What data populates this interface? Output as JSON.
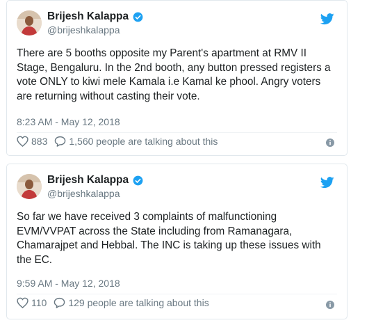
{
  "tweets": [
    {
      "author_name": "Brijesh Kalappa",
      "handle": "@brijeshkalappa",
      "text": "There are 5 booths opposite my Parent's apartment at RMV II Stage, Bengaluru. In the 2nd booth, any button pressed registers a vote ONLY to kiwi mele Kamala i.e Kamal ke phool. Angry voters are returning without casting their vote.",
      "timestamp": "8:23 AM - May 12, 2018",
      "likes": "883",
      "talking": "1,560 people are talking about this"
    },
    {
      "author_name": "Brijesh Kalappa",
      "handle": "@brijeshkalappa",
      "text": "So far we have received 3 complaints of malfunctioning EVM/VVPAT across the State including from Ramanagara, Chamarajpet and Hebbal. The INC is taking up these issues with the EC.",
      "timestamp": "9:59 AM - May 12, 2018",
      "likes": "110",
      "talking": "129 people are talking about this"
    }
  ],
  "colors": {
    "twitter_blue": "#1da1f2",
    "muted_text": "#697882",
    "border": "#e1e8ed"
  },
  "icons": [
    "avatar",
    "verified-badge-icon",
    "twitter-bird-icon",
    "heart-icon",
    "reply-bubble-icon",
    "info-icon"
  ]
}
